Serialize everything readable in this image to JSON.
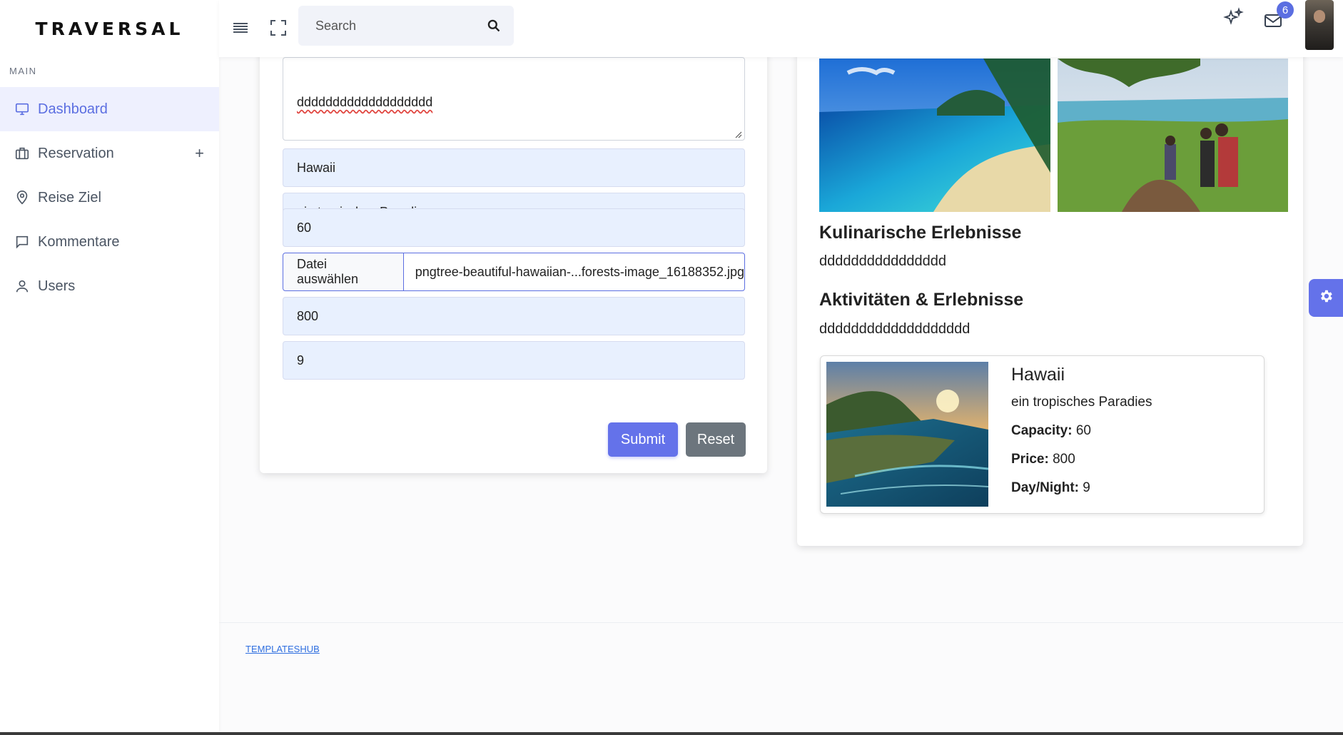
{
  "brand": "TRAVERSAL",
  "sidebar": {
    "section_label": "MAIN",
    "items": [
      {
        "label": "Dashboard",
        "icon": "monitor-icon",
        "active": true
      },
      {
        "label": "Reservation",
        "icon": "briefcase-icon",
        "has_plus": true,
        "plus": "+"
      },
      {
        "label": "Reise Ziel",
        "icon": "map-pin-icon"
      },
      {
        "label": "Kommentare",
        "icon": "comment-icon"
      },
      {
        "label": "Users",
        "icon": "user-icon"
      }
    ]
  },
  "header": {
    "search_placeholder": "Search",
    "mail_badge": "6"
  },
  "form": {
    "description_value": "ddddddddddddddddddd",
    "title_value": "Hawaii",
    "subtitle_value": "ein tropisches Paradies",
    "capacity_value": "60",
    "file_button": "Datei auswählen",
    "file_name": "pngtree-beautiful-hawaiian-...forests-image_16188352.jpg",
    "price_value": "800",
    "day_night_value": "9",
    "submit_label": "Submit",
    "reset_label": "Reset"
  },
  "preview": {
    "kulinarisch_heading": "Kulinarische Erlebnisse",
    "kulinarisch_text": "dddddddddddddddd",
    "aktivitaeten_heading": "Aktivitäten & Erlebnisse",
    "aktivitaeten_text": "ddddddddddddddddddd",
    "card": {
      "title": "Hawaii",
      "subtitle": "ein tropisches Paradies",
      "capacity_label": "Capacity:",
      "capacity_value": "60",
      "price_label": "Price:",
      "price_value": "800",
      "day_night_label": "Day/Night:",
      "day_night_value": "9"
    }
  },
  "footer": {
    "link": "TEMPLATESHUB"
  },
  "colors": {
    "accent": "#6472ea",
    "active_bg": "#eef0fe",
    "reset": "#6c757d",
    "input_bg": "#e8f0fe"
  }
}
